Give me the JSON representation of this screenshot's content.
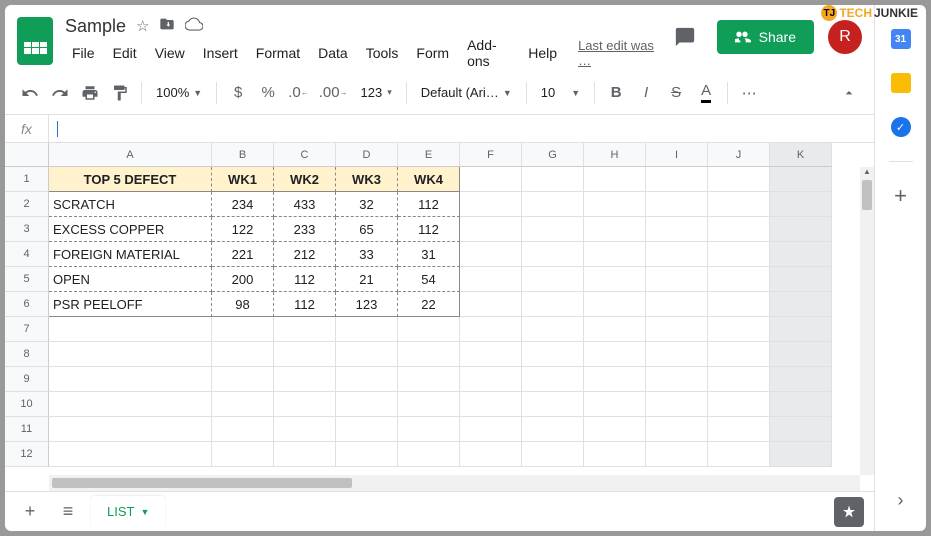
{
  "watermark": {
    "tech": "TECH",
    "junkie": "JUNKIE",
    "icon": "TJ"
  },
  "doc_title": "Sample",
  "menu": [
    "File",
    "Edit",
    "View",
    "Insert",
    "Format",
    "Data",
    "Tools",
    "Form",
    "Add-ons",
    "Help"
  ],
  "last_edit": "Last edit was …",
  "share_label": "Share",
  "avatar_letter": "R",
  "toolbar": {
    "zoom": "100%",
    "font": "Default (Ari…",
    "font_size": "10",
    "number_format": "123"
  },
  "sheet_tab": "LIST",
  "side_calendar_day": "31",
  "columns": [
    "A",
    "B",
    "C",
    "D",
    "E",
    "F",
    "G",
    "H",
    "I",
    "J",
    "K"
  ],
  "row_numbers": [
    1,
    2,
    3,
    4,
    5,
    6,
    7,
    8,
    9,
    10,
    11,
    12
  ],
  "table": {
    "headers": [
      "TOP 5 DEFECT",
      "WK1",
      "WK2",
      "WK3",
      "WK4"
    ],
    "rows": [
      [
        "SCRATCH",
        234,
        433,
        32,
        112
      ],
      [
        "EXCESS COPPER",
        122,
        233,
        65,
        112
      ],
      [
        "FOREIGN MATERIAL",
        221,
        212,
        33,
        31
      ],
      [
        "OPEN",
        200,
        112,
        21,
        54
      ],
      [
        "PSR PEELOFF",
        98,
        112,
        123,
        22
      ]
    ]
  },
  "chart_data": {
    "type": "table",
    "title": "TOP 5 DEFECT",
    "columns": [
      "WK1",
      "WK2",
      "WK3",
      "WK4"
    ],
    "categories": [
      "SCRATCH",
      "EXCESS COPPER",
      "FOREIGN MATERIAL",
      "OPEN",
      "PSR PEELOFF"
    ],
    "series": [
      {
        "name": "WK1",
        "values": [
          234,
          122,
          221,
          200,
          98
        ]
      },
      {
        "name": "WK2",
        "values": [
          433,
          233,
          212,
          112,
          112
        ]
      },
      {
        "name": "WK3",
        "values": [
          32,
          65,
          33,
          21,
          123
        ]
      },
      {
        "name": "WK4",
        "values": [
          112,
          112,
          31,
          54,
          22
        ]
      }
    ]
  }
}
